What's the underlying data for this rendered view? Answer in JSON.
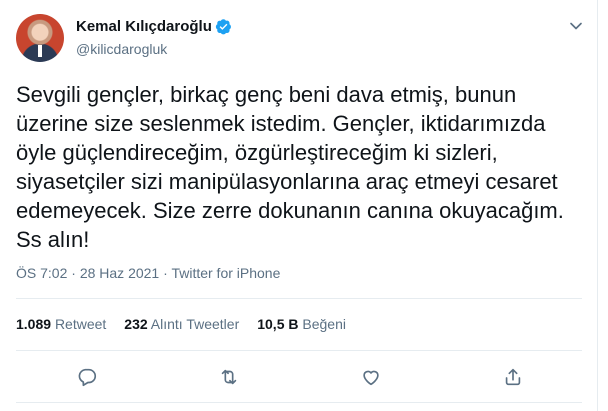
{
  "author": {
    "name": "Kemal Kılıçdaroğlu",
    "handle": "@kilicdarogluk"
  },
  "tweet": {
    "text": "Sevgili gençler, birkaç genç beni dava etmiş, bunun\nüzerine size seslenmek istedim. Gençler, iktidarımızda\nöyle güçlendireceğim, özgürleştireceğim ki sizleri,\nsiyasetçiler sizi manipülasyonlarına araç etmeyi cesaret\nedemeyecek. Size zerre dokunanın canına okuyacağım.\nSs alın!",
    "time": "ÖS 7:02",
    "date": "28 Haz 2021",
    "source": "Twitter for iPhone",
    "separator": "·"
  },
  "stats": [
    {
      "value": "1.089",
      "label": "Retweet"
    },
    {
      "value": "232",
      "label": "Alıntı Tweetler"
    },
    {
      "value": "10,5 B",
      "label": "Beğeni"
    }
  ],
  "actions": [
    "reply-icon",
    "retweet-icon",
    "like-icon",
    "share-icon"
  ],
  "colors": {
    "accent": "#1da1f2",
    "secondary_text": "#5b7083",
    "border": "#e6ecf0"
  }
}
